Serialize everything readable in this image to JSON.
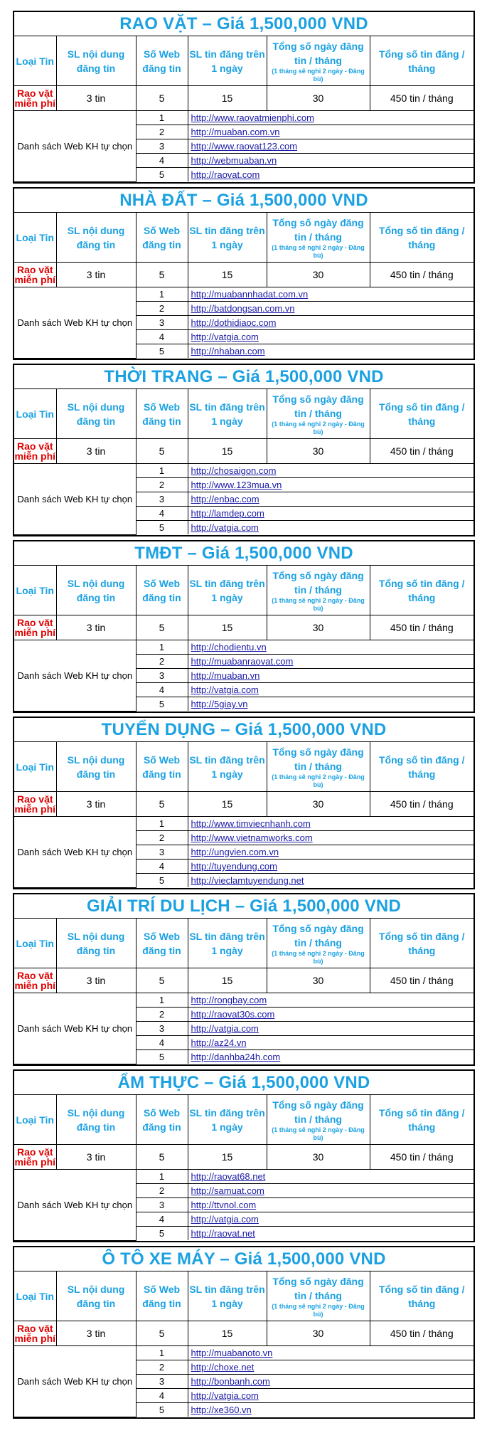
{
  "headers": {
    "loai_tin": "Loại Tin",
    "sl_noi_dung": "SL nội dung đăng tin",
    "so_web": "Số Web đăng tin",
    "sl_tin_ngay": "SL tin đăng trên 1 ngày",
    "tong_ngay": "Tổng số ngày đăng tin / tháng",
    "tong_ngay_note": "(1 tháng sẽ nghỉ 2 ngày - Đăng bù)",
    "tong_tin": "Tổng số tin đăng / tháng"
  },
  "values": {
    "loai_tin": "Rao vặt miễn phí",
    "sl_noi_dung": "3 tin",
    "so_web": "5",
    "sl_tin_ngay": "15",
    "tong_ngay": "30",
    "tong_tin": "450 tin / tháng"
  },
  "list_label": "Danh sách Web KH tự chọn",
  "packages": [
    {
      "title": "RAO VẶT – Giá 1,500,000 VND",
      "sites": [
        {
          "num": "1",
          "url": "http://www.raovatmienphi.com"
        },
        {
          "num": "2",
          "url": "http://muaban.com.vn"
        },
        {
          "num": "3",
          "url": "http://www.raovat123.com"
        },
        {
          "num": "4",
          "url": "http://webmuaban.vn"
        },
        {
          "num": "5",
          "url": "http://raovat.com"
        }
      ]
    },
    {
      "title": "NHÀ ĐẤT – Giá 1,500,000 VND",
      "sites": [
        {
          "num": "1",
          "url": "http://muabannhadat.com.vn"
        },
        {
          "num": "2",
          "url": "http://batdongsan.com.vn"
        },
        {
          "num": "3",
          "url": "http://dothidiaoc.com"
        },
        {
          "num": "4",
          "url": "http://vatgia.com"
        },
        {
          "num": "5",
          "url": "http://nhaban.com"
        }
      ]
    },
    {
      "title": "THỜI TRANG – Giá 1,500,000 VND",
      "sites": [
        {
          "num": "1",
          "url": "http://chosaigon.com"
        },
        {
          "num": "2",
          "url": "http://www.123mua.vn"
        },
        {
          "num": "3",
          "url": "http://enbac.com"
        },
        {
          "num": "4",
          "url": "http://lamdep.com"
        },
        {
          "num": "5",
          "url": "http://vatgia.com"
        }
      ]
    },
    {
      "title": "TMĐT – Giá 1,500,000 VND",
      "sites": [
        {
          "num": "1",
          "url": "http://chodientu.vn"
        },
        {
          "num": "2",
          "url": "http://muabanraovat.com"
        },
        {
          "num": "3",
          "url": "http://muaban.vn"
        },
        {
          "num": "4",
          "url": "http://vatgia.com"
        },
        {
          "num": "5",
          "url": "http://5giay.vn"
        }
      ]
    },
    {
      "title": "TUYỂN DỤNG – Giá 1,500,000 VND",
      "sites": [
        {
          "num": "1",
          "url": "http://www.timviecnhanh.com"
        },
        {
          "num": "2",
          "url": "http://www.vietnamworks.com"
        },
        {
          "num": "3",
          "url": "http://ungvien.com.vn"
        },
        {
          "num": "4",
          "url": "http://tuyendung.com"
        },
        {
          "num": "5",
          "url": "http://vieclamtuyendung.net"
        }
      ]
    },
    {
      "title": "GIẢI TRÍ DU LỊCH – Giá 1,500,000 VND",
      "sites": [
        {
          "num": "1",
          "url": "http://rongbay.com"
        },
        {
          "num": "2",
          "url": "http://raovat30s.com"
        },
        {
          "num": "3",
          "url": "http://vatgia.com"
        },
        {
          "num": "4",
          "url": "http://az24.vn"
        },
        {
          "num": "5",
          "url": "http://danhba24h.com"
        }
      ]
    },
    {
      "title": "ẨM THỰC – Giá 1,500,000 VND",
      "sites": [
        {
          "num": "1",
          "url": "http://raovat68.net"
        },
        {
          "num": "2",
          "url": "http://samuat.com"
        },
        {
          "num": "3",
          "url": "http://ttvnol.com"
        },
        {
          "num": "4",
          "url": "http://vatgia.com"
        },
        {
          "num": "5",
          "url": "http://raovat.net"
        }
      ]
    },
    {
      "title": "Ô TÔ XE MÁY – Giá 1,500,000 VND",
      "sites": [
        {
          "num": "1",
          "url": "http://muabanoto.vn"
        },
        {
          "num": "2",
          "url": "http://choxe.net"
        },
        {
          "num": "3",
          "url": "http://bonbanh.com"
        },
        {
          "num": "4",
          "url": "http://vatgia.com"
        },
        {
          "num": "5",
          "url": "http://xe360.vn"
        }
      ]
    }
  ]
}
